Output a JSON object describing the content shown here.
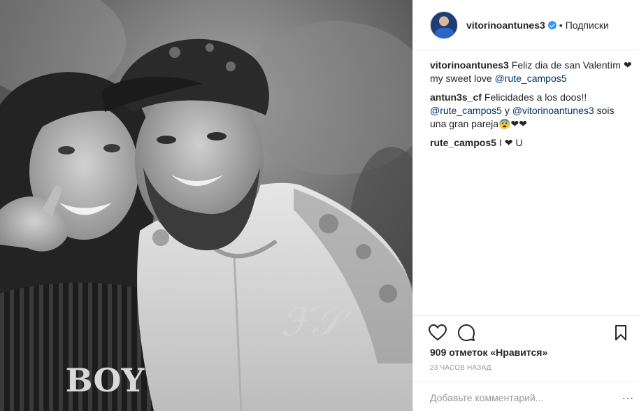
{
  "post": {
    "photo_alt": "",
    "author": {
      "username": "vitorinoantunes3",
      "verified": true,
      "follow_label": "Подписки",
      "separator": "•"
    },
    "comments": [
      {
        "user": "vitorinoantunes3",
        "parts": [
          {
            "text": "Feliz dia de san Valentím ❤ my sweet love ",
            "mention": false
          },
          {
            "text": "@rute_campos5",
            "mention": true
          }
        ]
      },
      {
        "user": "antun3s_cf",
        "parts": [
          {
            "text": "Felicidades a los doos!! ",
            "mention": false
          },
          {
            "text": "@rute_campos5",
            "mention": true
          },
          {
            "text": " y ",
            "mention": false
          },
          {
            "text": "@vitorinoantunes3",
            "mention": true
          },
          {
            "text": " sois una gran pareja😨❤❤",
            "mention": false
          }
        ]
      },
      {
        "user": "rute_campos5",
        "parts": [
          {
            "text": "I ❤ U",
            "mention": false
          }
        ]
      }
    ],
    "likes": "909 отметок «Нравится»",
    "time": "23 ЧАСОВ НАЗАД",
    "add_comment_placeholder": "Добавьте комментарий...",
    "more": "···"
  },
  "icons": {
    "like": "heart-icon",
    "comment": "comment-icon",
    "save": "bookmark-icon",
    "verified": "verified-badge-icon"
  },
  "colors": {
    "text": "#262626",
    "mention": "#003569",
    "muted": "#999999",
    "verified": "#3897f0",
    "border": "#efefef"
  }
}
